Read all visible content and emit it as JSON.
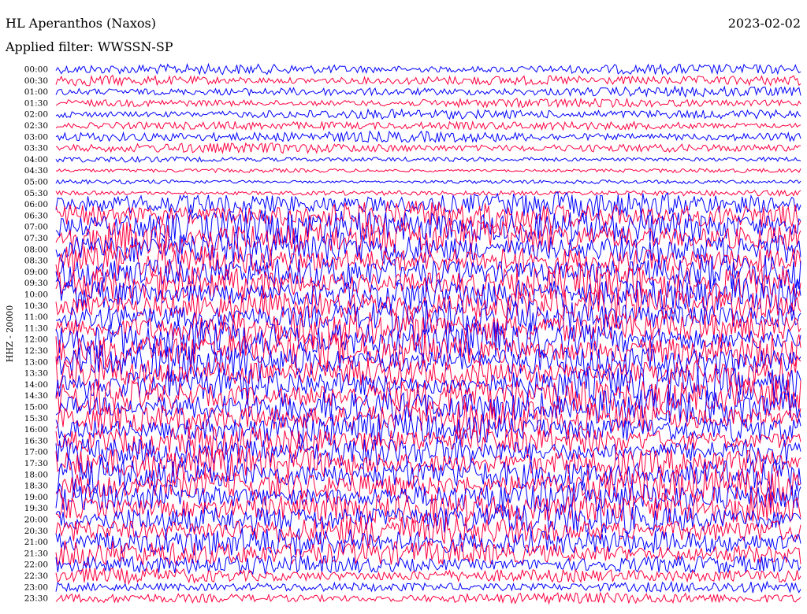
{
  "header": {
    "station": "HL Aperanthos (Naxos)",
    "date": "2023-02-02",
    "filter": "Applied filter: WWSSN-SP"
  },
  "colors": {
    "trace_a": "#0000ff",
    "trace_b": "#ff0040",
    "background": "#ffffff",
    "text": "#000000"
  },
  "chart_data": {
    "type": "line",
    "title": "HL Aperanthos (Naxos)",
    "subtitle": "Applied filter: WWSSN-SP",
    "date": "2023-02-02",
    "ylabel": "HHZ - 20000",
    "xlabel": "",
    "y_ticks": [
      "00:00",
      "00:30",
      "01:00",
      "01:30",
      "02:00",
      "02:30",
      "03:00",
      "03:30",
      "04:00",
      "04:30",
      "05:00",
      "05:30",
      "06:00",
      "06:30",
      "07:00",
      "07:30",
      "08:00",
      "08:30",
      "09:00",
      "09:30",
      "10:00",
      "10:30",
      "11:00",
      "11:30",
      "12:00",
      "12:30",
      "13:00",
      "13:30",
      "14:00",
      "14:30",
      "15:00",
      "15:30",
      "16:00",
      "16:30",
      "17:00",
      "17:30",
      "18:00",
      "18:30",
      "19:00",
      "19:30",
      "20:00",
      "20:30",
      "21:00",
      "21:30",
      "22:00",
      "22:30",
      "23:00",
      "23:30"
    ],
    "series": [
      {
        "color": "#0000ff",
        "line_start_times": [
          "00:00",
          "01:00",
          "02:00",
          "03:00",
          "04:00",
          "05:00",
          "06:00",
          "07:00",
          "08:00",
          "09:00",
          "10:00",
          "11:00",
          "12:00",
          "13:00",
          "14:00",
          "15:00",
          "16:00",
          "17:00",
          "18:00",
          "19:00",
          "20:00",
          "21:00",
          "22:00",
          "23:00"
        ]
      },
      {
        "color": "#ff0040",
        "line_start_times": [
          "00:30",
          "01:30",
          "02:30",
          "03:30",
          "04:30",
          "05:30",
          "06:30",
          "07:30",
          "08:30",
          "09:30",
          "10:30",
          "11:30",
          "12:30",
          "13:30",
          "14:30",
          "15:30",
          "16:30",
          "17:30",
          "18:30",
          "19:30",
          "20:30",
          "21:30",
          "22:30",
          "23:30"
        ]
      }
    ],
    "relative_amplitude": [
      1.0,
      1.0,
      0.9,
      0.8,
      0.9,
      0.8,
      1.0,
      0.9,
      0.5,
      0.4,
      0.4,
      0.5,
      2.2,
      2.6,
      3.2,
      3.4,
      3.2,
      3.0,
      3.2,
      3.4,
      3.2,
      3.0,
      3.0,
      3.2,
      3.4,
      3.4,
      3.2,
      3.0,
      3.2,
      3.4,
      3.2,
      3.0,
      2.8,
      2.6,
      2.8,
      3.0,
      3.2,
      3.0,
      2.8,
      3.0,
      2.8,
      2.6,
      2.6,
      2.4,
      1.8,
      1.4,
      1.0,
      1.0
    ],
    "grid": false,
    "legend": "none"
  }
}
